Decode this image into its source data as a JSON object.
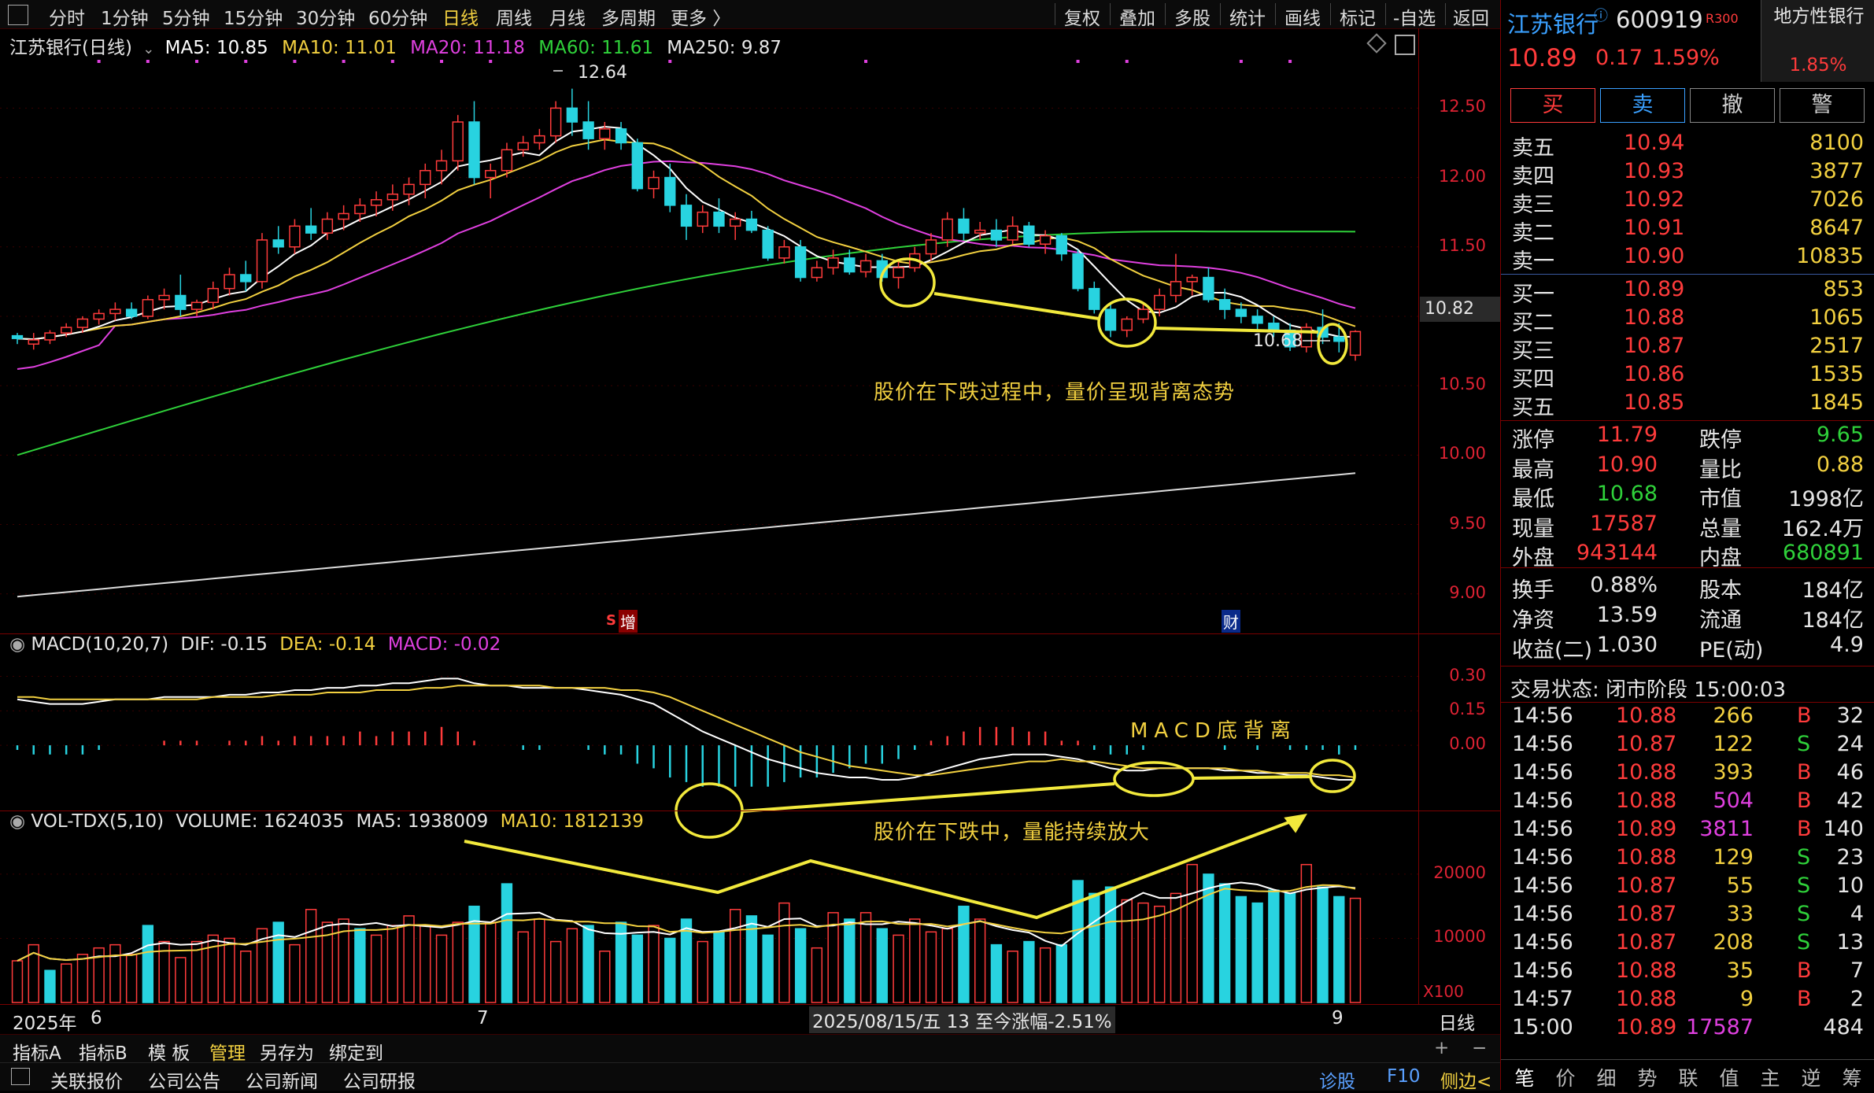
{
  "toolbar": {
    "left": [
      "分时",
      "1分钟",
      "5分钟",
      "15分钟",
      "30分钟",
      "60分钟",
      "日线",
      "周线",
      "月线",
      "多周期",
      "更多 〉"
    ],
    "active": "日线",
    "right": [
      "复权",
      "叠加",
      "多股",
      "统计",
      "画线",
      "标记",
      "-自选",
      "返回"
    ]
  },
  "main_legend": {
    "title": "江苏银行(日线)",
    "ma5": "MA5: 10.85",
    "ma10": "MA10: 11.01",
    "ma20": "MA20: 11.18",
    "ma60": "MA60: 11.61",
    "ma250": "MA250: 9.87"
  },
  "macd_legend": {
    "title": "MACD(10,20,7)",
    "dif": "DIF: -0.15",
    "dea": "DEA: -0.14",
    "macd": "MACD: -0.02"
  },
  "vol_legend": {
    "title": "VOL-TDX(5,10)",
    "volume": "VOLUME: 1624035",
    "ma5": "MA5: 1938009",
    "ma10": "MA10: 1812139"
  },
  "annotations": {
    "price_text": "股价在下跌过程中，量价呈现背离态势",
    "macd_text": "MACD底背离",
    "vol_text": "股价在下跌中，量能持续放大",
    "high_label": "12.64",
    "low_label": "10.68",
    "current_price_tag": "10.82",
    "marker_zeng": "增",
    "marker_s": "S",
    "marker_cai": "财"
  },
  "x_axis": {
    "year": "2025年",
    "m6": "6",
    "m7": "7",
    "m9": "9",
    "period": "日线",
    "cursor": "2025/08/15/五 13 至今涨幅-2.51%",
    "unit": "X100"
  },
  "bottom_bar1": [
    "指标A",
    "指标B",
    "模 板",
    "管理",
    "另存为",
    "绑定到"
  ],
  "bottom_bar2": [
    "关联报价",
    "公司公告",
    "公司新闻",
    "公司研报"
  ],
  "bottom_right": [
    "诊股",
    "F10",
    "侧边<"
  ],
  "quote": {
    "name": "江苏银行",
    "code": "600919",
    "tag": "R300",
    "sector": "地方性银行",
    "sector_pct": "1.85%",
    "price": "10.89",
    "change": "0.17",
    "pct": "1.59%",
    "buttons": [
      "买",
      "卖",
      "撤",
      "警"
    ],
    "asks": [
      {
        "label": "卖五",
        "price": "10.94",
        "vol": "8100"
      },
      {
        "label": "卖四",
        "price": "10.93",
        "vol": "3877"
      },
      {
        "label": "卖三",
        "price": "10.92",
        "vol": "7026"
      },
      {
        "label": "卖二",
        "price": "10.91",
        "vol": "8647"
      },
      {
        "label": "卖一",
        "price": "10.90",
        "vol": "10835"
      }
    ],
    "bids": [
      {
        "label": "买一",
        "price": "10.89",
        "vol": "853"
      },
      {
        "label": "买二",
        "price": "10.88",
        "vol": "1065"
      },
      {
        "label": "买三",
        "price": "10.87",
        "vol": "2517"
      },
      {
        "label": "买四",
        "price": "10.86",
        "vol": "1535"
      },
      {
        "label": "买五",
        "price": "10.85",
        "vol": "1845"
      }
    ],
    "stats": [
      [
        "涨停",
        "11.79",
        "跌停",
        "9.65"
      ],
      [
        "最高",
        "10.90",
        "量比",
        "0.88"
      ],
      [
        "最低",
        "10.68",
        "市值",
        "1998亿"
      ],
      [
        "现量",
        "17587",
        "总量",
        "162.4万"
      ],
      [
        "外盘",
        "943144",
        "内盘",
        "680891"
      ]
    ],
    "stats2": [
      [
        "换手",
        "0.88%",
        "股本",
        "184亿"
      ],
      [
        "净资",
        "13.59",
        "流通",
        "184亿"
      ],
      [
        "收益(二)",
        "1.030",
        "PE(动)",
        "4.9"
      ]
    ],
    "status": "交易状态: 闭市阶段 15:00:03",
    "ticks": [
      [
        "14:56",
        "10.88",
        "266",
        "B",
        "32"
      ],
      [
        "14:56",
        "10.87",
        "122",
        "S",
        "24"
      ],
      [
        "14:56",
        "10.88",
        "393",
        "B",
        "46"
      ],
      [
        "14:56",
        "10.88",
        "504",
        "B",
        "42"
      ],
      [
        "14:56",
        "10.89",
        "3811",
        "B",
        "140"
      ],
      [
        "14:56",
        "10.88",
        "129",
        "S",
        "23"
      ],
      [
        "14:56",
        "10.87",
        "55",
        "S",
        "10"
      ],
      [
        "14:56",
        "10.87",
        "33",
        "S",
        "4"
      ],
      [
        "14:56",
        "10.87",
        "208",
        "S",
        "13"
      ],
      [
        "14:56",
        "10.88",
        "35",
        "B",
        "7"
      ],
      [
        "14:57",
        "10.88",
        "9",
        "B",
        "2"
      ],
      [
        "15:00",
        "10.89",
        "17587",
        "",
        "484"
      ]
    ],
    "bottom_tabs": [
      "笔",
      "价",
      "细",
      "势",
      "联",
      "值",
      "主",
      "逆",
      "筹"
    ]
  },
  "chart_data": [
    {
      "type": "candlestick",
      "title": "江苏银行(日线)",
      "y_ticks": [
        12.5,
        12.0,
        11.5,
        11.0,
        10.5,
        10.0,
        9.5,
        9.0
      ],
      "ylim": [
        8.8,
        12.95
      ],
      "ohlc": [
        [
          10.86,
          10.88,
          10.8,
          10.84
        ],
        [
          10.8,
          10.88,
          10.76,
          10.83
        ],
        [
          10.83,
          10.9,
          10.8,
          10.88
        ],
        [
          10.88,
          10.95,
          10.85,
          10.92
        ],
        [
          10.92,
          11.0,
          10.88,
          10.98
        ],
        [
          10.98,
          11.05,
          10.94,
          11.02
        ],
        [
          11.02,
          11.1,
          10.97,
          11.05
        ],
        [
          11.05,
          11.1,
          10.98,
          11.0
        ],
        [
          11.0,
          11.15,
          10.98,
          11.12
        ],
        [
          11.12,
          11.2,
          11.05,
          11.15
        ],
        [
          11.15,
          11.3,
          11.0,
          11.05
        ],
        [
          11.05,
          11.12,
          11.0,
          11.1
        ],
        [
          11.1,
          11.25,
          11.05,
          11.2
        ],
        [
          11.2,
          11.35,
          11.15,
          11.3
        ],
        [
          11.3,
          11.4,
          11.18,
          11.25
        ],
        [
          11.25,
          11.6,
          11.2,
          11.55
        ],
        [
          11.55,
          11.65,
          11.45,
          11.5
        ],
        [
          11.5,
          11.7,
          11.45,
          11.65
        ],
        [
          11.65,
          11.78,
          11.55,
          11.6
        ],
        [
          11.6,
          11.75,
          11.55,
          11.7
        ],
        [
          11.7,
          11.8,
          11.62,
          11.74
        ],
        [
          11.74,
          11.85,
          11.68,
          11.8
        ],
        [
          11.8,
          11.9,
          11.72,
          11.84
        ],
        [
          11.84,
          11.95,
          11.76,
          11.88
        ],
        [
          11.88,
          12.0,
          11.8,
          11.95
        ],
        [
          11.95,
          12.1,
          11.85,
          12.05
        ],
        [
          12.05,
          12.2,
          11.95,
          12.12
        ],
        [
          12.12,
          12.45,
          12.05,
          12.4
        ],
        [
          12.4,
          12.55,
          11.95,
          12.0
        ],
        [
          12.0,
          12.1,
          11.85,
          12.05
        ],
        [
          12.05,
          12.25,
          12.0,
          12.2
        ],
        [
          12.2,
          12.3,
          12.15,
          12.25
        ],
        [
          12.25,
          12.35,
          12.2,
          12.3
        ],
        [
          12.3,
          12.55,
          12.25,
          12.5
        ],
        [
          12.5,
          12.64,
          12.3,
          12.4
        ],
        [
          12.4,
          12.55,
          12.2,
          12.28
        ],
        [
          12.28,
          12.4,
          12.2,
          12.35
        ],
        [
          12.35,
          12.4,
          12.2,
          12.25
        ],
        [
          12.25,
          12.28,
          11.9,
          11.92
        ],
        [
          11.92,
          12.05,
          11.85,
          12.0
        ],
        [
          12.0,
          12.1,
          11.75,
          11.8
        ],
        [
          11.8,
          11.88,
          11.55,
          11.65
        ],
        [
          11.65,
          11.8,
          11.6,
          11.75
        ],
        [
          11.75,
          11.85,
          11.6,
          11.65
        ],
        [
          11.65,
          11.75,
          11.55,
          11.7
        ],
        [
          11.7,
          11.76,
          11.6,
          11.62
        ],
        [
          11.62,
          11.65,
          11.4,
          11.42
        ],
        [
          11.42,
          11.55,
          11.38,
          11.5
        ],
        [
          11.5,
          11.55,
          11.25,
          11.28
        ],
        [
          11.28,
          11.4,
          11.25,
          11.35
        ],
        [
          11.35,
          11.48,
          11.3,
          11.42
        ],
        [
          11.42,
          11.48,
          11.3,
          11.32
        ],
        [
          11.32,
          11.45,
          11.28,
          11.4
        ],
        [
          11.4,
          11.45,
          11.25,
          11.28
        ],
        [
          11.28,
          11.4,
          11.2,
          11.35
        ],
        [
          11.35,
          11.5,
          11.32,
          11.45
        ],
        [
          11.45,
          11.6,
          11.4,
          11.55
        ],
        [
          11.55,
          11.75,
          11.5,
          11.7
        ],
        [
          11.7,
          11.78,
          11.55,
          11.6
        ],
        [
          11.6,
          11.68,
          11.55,
          11.62
        ],
        [
          11.62,
          11.7,
          11.5,
          11.55
        ],
        [
          11.55,
          11.72,
          11.52,
          11.65
        ],
        [
          11.65,
          11.68,
          11.5,
          11.52
        ],
        [
          11.52,
          11.62,
          11.45,
          11.58
        ],
        [
          11.58,
          11.6,
          11.4,
          11.45
        ],
        [
          11.45,
          11.48,
          11.18,
          11.2
        ],
        [
          11.2,
          11.25,
          11.02,
          11.05
        ],
        [
          11.05,
          11.1,
          10.85,
          10.9
        ],
        [
          10.9,
          11.0,
          10.85,
          10.98
        ],
        [
          10.98,
          11.1,
          10.95,
          11.05
        ],
        [
          11.05,
          11.2,
          11.0,
          11.15
        ],
        [
          11.15,
          11.45,
          11.1,
          11.25
        ],
        [
          11.25,
          11.3,
          11.15,
          11.28
        ],
        [
          11.28,
          11.35,
          11.1,
          11.12
        ],
        [
          11.12,
          11.2,
          10.98,
          11.05
        ],
        [
          11.05,
          11.1,
          10.95,
          11.0
        ],
        [
          11.0,
          11.05,
          10.9,
          10.95
        ],
        [
          10.95,
          11.0,
          10.85,
          10.9
        ],
        [
          10.9,
          10.95,
          10.75,
          10.78
        ],
        [
          10.78,
          10.95,
          10.74,
          10.92
        ],
        [
          10.92,
          11.05,
          10.8,
          10.85
        ],
        [
          10.85,
          10.95,
          10.74,
          10.82
        ],
        [
          10.72,
          10.9,
          10.68,
          10.89
        ]
      ],
      "ma5_last": 10.85,
      "ma10_last": 11.01,
      "ma20_last": 11.18,
      "ma60_last": 11.61,
      "ma250_last": 9.87
    },
    {
      "type": "macd",
      "title": "MACD(10,20,7)",
      "y_ticks": [
        0.3,
        0.15,
        0.0
      ],
      "dif": [
        0.2,
        0.19,
        0.18,
        0.18,
        0.18,
        0.19,
        0.2,
        0.2,
        0.2,
        0.21,
        0.21,
        0.21,
        0.21,
        0.22,
        0.22,
        0.23,
        0.23,
        0.24,
        0.24,
        0.25,
        0.25,
        0.26,
        0.26,
        0.27,
        0.27,
        0.28,
        0.29,
        0.29,
        0.27,
        0.26,
        0.26,
        0.25,
        0.25,
        0.25,
        0.25,
        0.24,
        0.23,
        0.22,
        0.2,
        0.18,
        0.14,
        0.1,
        0.06,
        0.03,
        0.0,
        -0.03,
        -0.06,
        -0.08,
        -0.1,
        -0.12,
        -0.13,
        -0.14,
        -0.14,
        -0.15,
        -0.15,
        -0.14,
        -0.12,
        -0.1,
        -0.08,
        -0.06,
        -0.05,
        -0.04,
        -0.04,
        -0.04,
        -0.05,
        -0.06,
        -0.08,
        -0.1,
        -0.11,
        -0.11,
        -0.1,
        -0.1,
        -0.1,
        -0.1,
        -0.11,
        -0.11,
        -0.12,
        -0.12,
        -0.13,
        -0.13,
        -0.14,
        -0.15,
        -0.15
      ],
      "dea": [
        0.21,
        0.21,
        0.2,
        0.2,
        0.2,
        0.2,
        0.2,
        0.2,
        0.2,
        0.2,
        0.2,
        0.2,
        0.21,
        0.21,
        0.21,
        0.21,
        0.22,
        0.22,
        0.22,
        0.23,
        0.23,
        0.23,
        0.24,
        0.24,
        0.24,
        0.25,
        0.25,
        0.26,
        0.26,
        0.26,
        0.26,
        0.26,
        0.26,
        0.25,
        0.25,
        0.25,
        0.25,
        0.24,
        0.24,
        0.23,
        0.21,
        0.18,
        0.15,
        0.12,
        0.09,
        0.06,
        0.03,
        0.0,
        -0.03,
        -0.05,
        -0.07,
        -0.09,
        -0.1,
        -0.11,
        -0.12,
        -0.13,
        -0.13,
        -0.12,
        -0.11,
        -0.1,
        -0.09,
        -0.08,
        -0.07,
        -0.07,
        -0.06,
        -0.07,
        -0.07,
        -0.08,
        -0.09,
        -0.1,
        -0.1,
        -0.1,
        -0.1,
        -0.1,
        -0.1,
        -0.11,
        -0.11,
        -0.12,
        -0.12,
        -0.12,
        -0.13,
        -0.13,
        -0.14
      ]
    },
    {
      "type": "bar",
      "title": "VOL-TDX(5,10)",
      "y_ticks": [
        20000,
        10000
      ],
      "ylim": [
        0,
        26000
      ],
      "volumes": [
        6500,
        9000,
        5000,
        6000,
        7500,
        8500,
        9000,
        7500,
        12000,
        9500,
        7000,
        9500,
        10500,
        10000,
        8000,
        11500,
        12500,
        9000,
        14500,
        12500,
        13000,
        11500,
        10500,
        12000,
        13500,
        12000,
        10500,
        12500,
        15000,
        12500,
        18500,
        11000,
        13000,
        9500,
        11500,
        12000,
        8000,
        12500,
        10500,
        12000,
        10000,
        13000,
        9500,
        11000,
        14500,
        13500,
        10500,
        15500,
        11500,
        8500,
        14000,
        13000,
        14000,
        11500,
        10500,
        13000,
        11000,
        11500,
        15000,
        13000,
        9000,
        8000,
        9500,
        8500,
        9000,
        19000,
        17000,
        18000,
        16000,
        15500,
        15000,
        17000,
        21500,
        20000,
        18500,
        16500,
        15500,
        17500,
        17000,
        21500,
        18000,
        16500,
        16240
      ],
      "up": [
        1,
        1,
        0,
        1,
        1,
        1,
        1,
        1,
        0,
        1,
        1,
        1,
        1,
        1,
        1,
        1,
        0,
        1,
        1,
        1,
        1,
        0,
        1,
        1,
        1,
        1,
        1,
        1,
        0,
        1,
        0,
        1,
        1,
        1,
        1,
        0,
        1,
        0,
        0,
        1,
        0,
        0,
        1,
        0,
        1,
        0,
        0,
        1,
        0,
        1,
        1,
        0,
        1,
        0,
        1,
        1,
        1,
        1,
        0,
        1,
        0,
        1,
        0,
        1,
        0,
        0,
        0,
        0,
        1,
        1,
        1,
        1,
        1,
        0,
        0,
        0,
        0,
        0,
        0,
        1,
        0,
        0,
        1
      ]
    }
  ]
}
